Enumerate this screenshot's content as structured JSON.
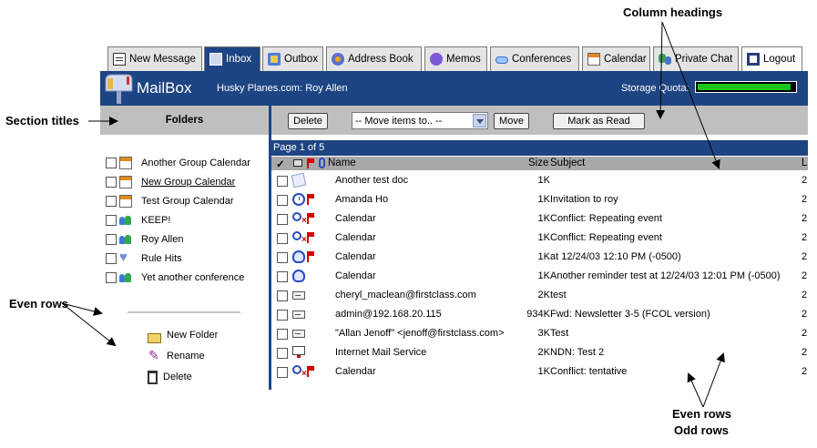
{
  "annotations": {
    "column_headings": "Column headings",
    "section_titles": "Section titles",
    "even_rows_left": "Even rows",
    "even_rows_right": "Even rows",
    "odd_rows_right": "Odd rows"
  },
  "tabs": [
    {
      "label": "New Message",
      "icon": "compose-icon"
    },
    {
      "label": "Inbox",
      "icon": "inbox-icon",
      "active": true
    },
    {
      "label": "Outbox",
      "icon": "outbox-icon"
    },
    {
      "label": "Address Book",
      "icon": "address-book-icon"
    },
    {
      "label": "Memos",
      "icon": "memos-icon"
    },
    {
      "label": "Conferences",
      "icon": "conferences-icon"
    },
    {
      "label": "Calendar",
      "icon": "calendar-icon"
    },
    {
      "label": "Private Chat",
      "icon": "chat-icon"
    },
    {
      "label": "Logout",
      "icon": "logout-icon"
    }
  ],
  "header": {
    "title": "MailBox",
    "user": "Husky Planes.com: Roy Allen",
    "quota_label": "Storage Quota:",
    "quota_fraction": 0.96,
    "quota_color": "#19c619",
    "brand_color": "#1e4583"
  },
  "folders": {
    "title": "Folders",
    "items": [
      {
        "label": "Another Group Calendar",
        "icon": "calendar-icon"
      },
      {
        "label": "New Group Calendar",
        "icon": "calendar-icon"
      },
      {
        "label": "Test Group Calendar",
        "icon": "calendar-icon"
      },
      {
        "label": "KEEP!",
        "icon": "people-icon"
      },
      {
        "label": "Roy Allen",
        "icon": "people-icon"
      },
      {
        "label": "Rule Hits",
        "icon": "heart-icon"
      },
      {
        "label": "Yet another conference",
        "icon": "people-icon"
      }
    ],
    "actions": {
      "new_folder": "New Folder",
      "rename": "Rename",
      "delete": "Delete"
    }
  },
  "toolbar": {
    "delete": "Delete",
    "move_select": "-- Move items to.. --",
    "move": "Move",
    "mark_read": "Mark as Read"
  },
  "pagebar": "Page 1 of 5",
  "columns": {
    "check": "✓",
    "name": "Name",
    "size": "Size",
    "subject": "Subject",
    "last": "L"
  },
  "messages": [
    {
      "icon": "document-icon",
      "flag": false,
      "name": "Another test doc",
      "size": "1K",
      "subject": "",
      "last": "2"
    },
    {
      "icon": "clock-icon",
      "flag": true,
      "name": "Amanda Ho",
      "size": "1K",
      "subject": "Invitation to roy",
      "last": "2"
    },
    {
      "icon": "conflict-icon",
      "flag": true,
      "name": "Calendar",
      "size": "1K",
      "subject": "Conflict: Repeating event",
      "last": "2"
    },
    {
      "icon": "conflict-icon",
      "flag": true,
      "name": "Calendar",
      "size": "1K",
      "subject": "Conflict: Repeating event",
      "last": "2"
    },
    {
      "icon": "alarm-icon",
      "flag": true,
      "name": "Calendar",
      "size": "1K",
      "subject": "at 12/24/03 12:10 PM (-0500)",
      "last": "2"
    },
    {
      "icon": "alarm-icon",
      "flag": false,
      "name": "Calendar",
      "size": "1K",
      "subject": "Another reminder test at 12/24/03 12:01 PM (-0500)",
      "last": "2"
    },
    {
      "icon": "envelope-icon",
      "flag": false,
      "name": "cheryl_maclean@firstclass.com",
      "size": "2K",
      "subject": "test",
      "last": "2"
    },
    {
      "icon": "envelope-icon",
      "flag": false,
      "name": "admin@192.168.20.115",
      "size": "934K",
      "subject": "Fwd: Newsletter 3-5 (FCOL version)",
      "last": "2"
    },
    {
      "icon": "envelope-icon",
      "flag": false,
      "name": "\"Allan Jenoff\" <jenoff@firstclass.com>",
      "size": "3K",
      "subject": "Test",
      "last": "2"
    },
    {
      "icon": "monitor-icon",
      "flag": false,
      "name": "Internet Mail Service",
      "size": "2K",
      "subject": "NDN: Test 2",
      "last": "2"
    },
    {
      "icon": "conflict-icon",
      "flag": true,
      "name": "Calendar",
      "size": "1K",
      "subject": "Conflict: tentative",
      "last": "2"
    }
  ]
}
